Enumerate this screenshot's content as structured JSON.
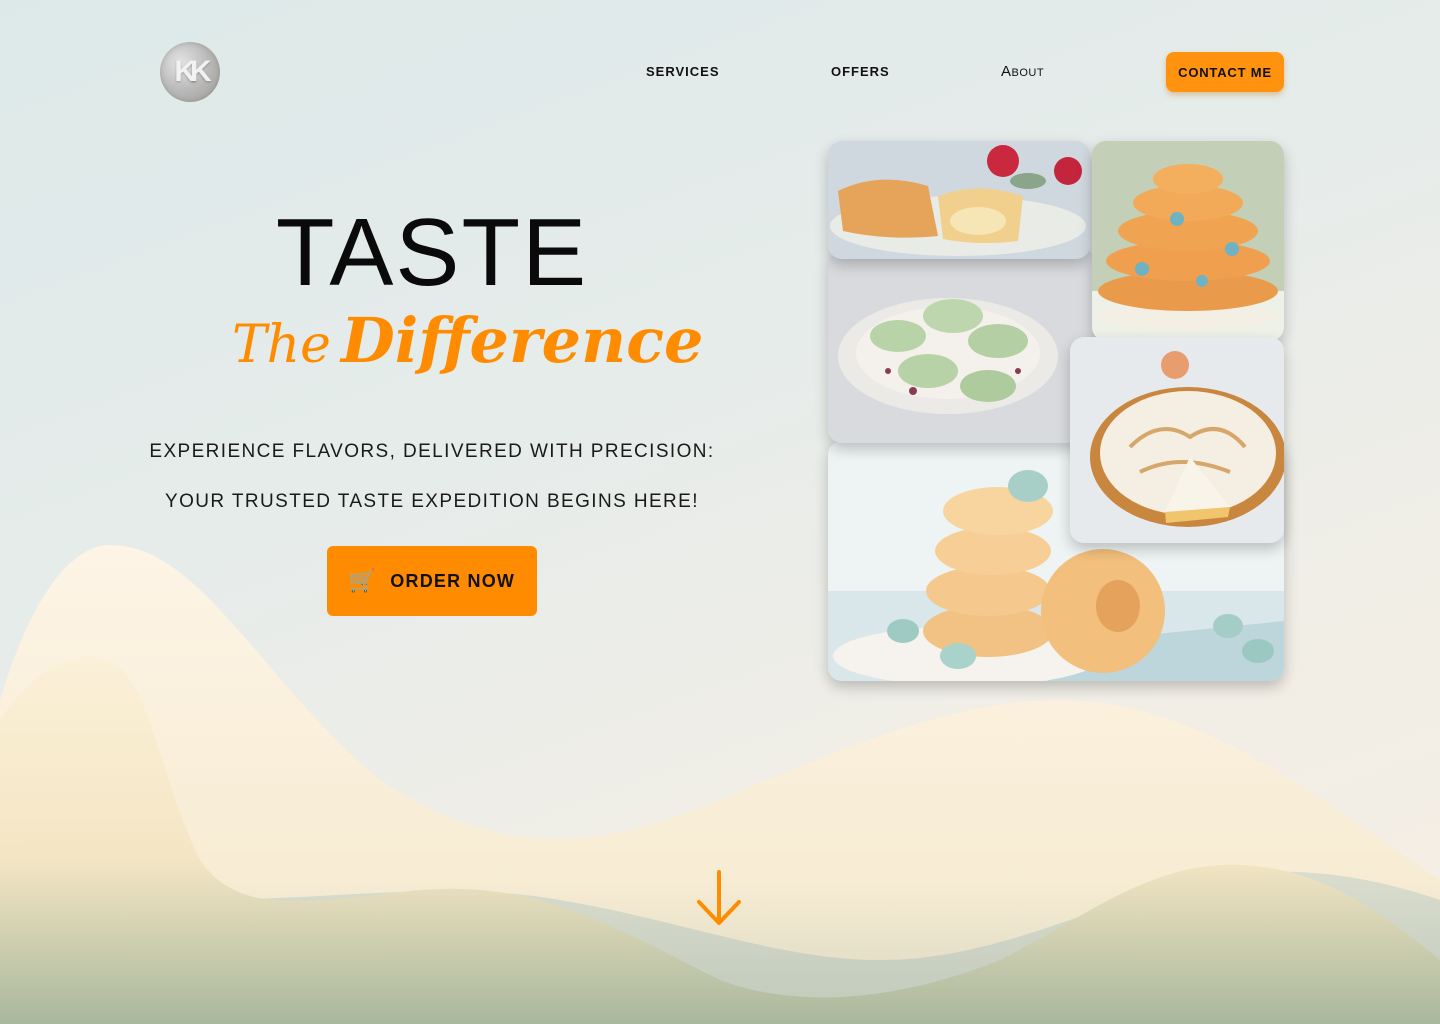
{
  "brand": {
    "logo_icon": "kk-logo-icon"
  },
  "nav": {
    "services": "SERVICES",
    "offers": "OFFERS",
    "about": "About",
    "contact": "CONTACT ME"
  },
  "hero": {
    "title": "TASTE",
    "subtitle_the": "The",
    "subtitle_difference": "Difference",
    "tagline_1": "EXPERIENCE FLAVORS, DELIVERED WITH PRECISION:",
    "tagline_2": "YOUR TRUSTED TASTE EXPEDITION BEGINS HERE!",
    "order_button": "ORDER NOW",
    "order_icon": "shopping-cart-icon"
  },
  "gallery": {
    "images": [
      "eclair-photo",
      "stacked-donuts-photo",
      "macarons-photo",
      "meringue-tart-photo",
      "glazed-donuts-photo"
    ]
  },
  "scroll": {
    "icon": "arrow-down-icon"
  },
  "colors": {
    "accent": "#ff8c00",
    "background": "#e6ecea",
    "wave": "#fbefd6"
  }
}
